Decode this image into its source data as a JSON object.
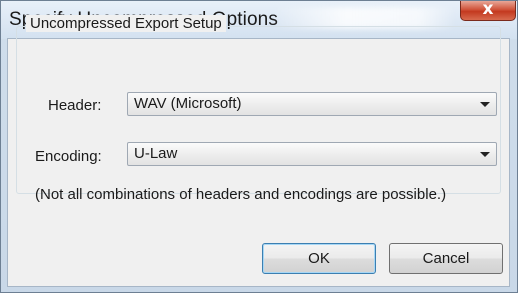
{
  "window": {
    "title": "Specify Uncompressed Options",
    "close_symbol": "x"
  },
  "group": {
    "label": "Uncompressed Export Setup"
  },
  "header": {
    "label": "Header:",
    "value": "WAV (Microsoft)"
  },
  "encoding": {
    "label": "Encoding:",
    "value": "U-Law"
  },
  "note": "(Not all combinations of headers and encodings are possible.)",
  "buttons": {
    "ok": "OK",
    "cancel": "Cancel"
  }
}
